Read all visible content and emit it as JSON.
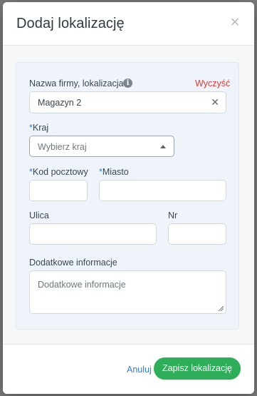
{
  "modal": {
    "title": "Dodaj lokalizację",
    "close_icon": "close-icon",
    "form": {
      "company": {
        "label": "Nazwa firmy, lokalizacja",
        "info_icon": "info-icon",
        "clear_label": "Wyczyść",
        "value": "Magazyn 2"
      },
      "country": {
        "required_marker": "*",
        "label": "Kraj",
        "value": "Wybierz kraj"
      },
      "postal_code": {
        "required_marker": "*",
        "label": "Kod pocztowy",
        "value": ""
      },
      "city": {
        "required_marker": "*",
        "label": "Miasto",
        "value": ""
      },
      "street": {
        "label": "Ulica",
        "value": ""
      },
      "number": {
        "label": "Nr",
        "value": ""
      },
      "additional_info": {
        "label": "Dodatkowe informacje",
        "placeholder": "Dodatkowe informacje"
      }
    },
    "footer": {
      "cancel_label": "Anuluj",
      "save_label": "Zapisz lokalizację"
    }
  },
  "colors": {
    "accent_blue": "#2e7fd6",
    "clear_red": "#e03b3b",
    "save_green": "#2fae5a",
    "panel_bg": "#eef4fa"
  }
}
